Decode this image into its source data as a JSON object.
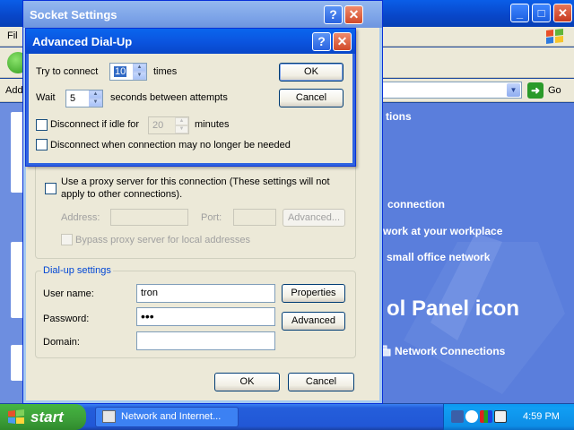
{
  "background": {
    "menu_file": "Fil",
    "address_label": "Add",
    "go_label": "Go",
    "content": {
      "heading": "tions",
      "task1": "connection",
      "task2": "work at your workplace",
      "task3": "small office network",
      "big_text": "ol Panel icon",
      "network_link": "Network Connections"
    }
  },
  "socket_settings": {
    "title": "Socket Settings",
    "help_button": "?",
    "close_button": "✕",
    "proxy": {
      "checkbox_label_line1": "Use a proxy server for this connection (These settings will not",
      "checkbox_label_line2": "apply to other connections).",
      "address_label": "Address:",
      "address_value": "",
      "port_label": "Port:",
      "port_value": "",
      "advanced_button": "Advanced...",
      "bypass_label": "Bypass proxy server for local addresses"
    },
    "dialup": {
      "legend": "Dial-up settings",
      "username_label": "User name:",
      "username_value": "tron",
      "password_label": "Password:",
      "password_value": "•••",
      "domain_label": "Domain:",
      "domain_value": "",
      "properties_button": "Properties",
      "advanced_button": "Advanced"
    },
    "ok_button": "OK",
    "cancel_button": "Cancel"
  },
  "advanced_dialup": {
    "title": "Advanced Dial-Up",
    "help_button": "?",
    "close_button": "✕",
    "try_label": "Try to connect",
    "try_value": "10",
    "times_label": "times",
    "wait_label": "Wait",
    "wait_value": "5",
    "seconds_label": "seconds between attempts",
    "idle_label": "Disconnect if idle for",
    "idle_value": "20",
    "minutes_label": "minutes",
    "disconnect_label": "Disconnect when connection may no longer be needed",
    "ok_button": "OK",
    "cancel_button": "Cancel"
  },
  "taskbar": {
    "start_label": "start",
    "task_button": "Network and Internet...",
    "clock": "4:59 PM"
  }
}
